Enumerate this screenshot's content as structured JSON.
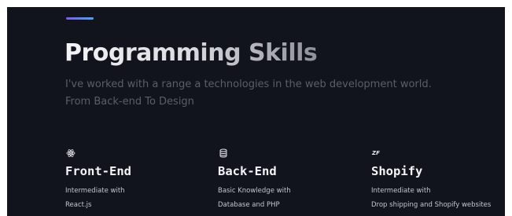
{
  "section": {
    "title": "Programming Skills",
    "intro": "I've worked with a range a technologies in the web development world. From Back-end To Design"
  },
  "skills": [
    {
      "icon": "react-icon",
      "name": "Front-End",
      "desc_line1": "Intermediate with",
      "desc_line2": "React.js"
    },
    {
      "icon": "database-icon",
      "name": "Back-End",
      "desc_line1": "Basic Knowledge with",
      "desc_line2": "Database and PHP"
    },
    {
      "icon": "zf-icon",
      "icon_text": "ZF",
      "name": "Shopify",
      "desc_line1": "Intermediate with",
      "desc_line2": "Drop shipping and Shopify websites"
    }
  ],
  "colors": {
    "background": "#12141d",
    "accent_start": "#7c5cf2",
    "accent_end": "#4aa3f5",
    "title": "#f4f4f6",
    "intro_text": "#5b5e69",
    "skill_name": "#f3f4f7",
    "skill_desc": "#c4c6cd"
  }
}
